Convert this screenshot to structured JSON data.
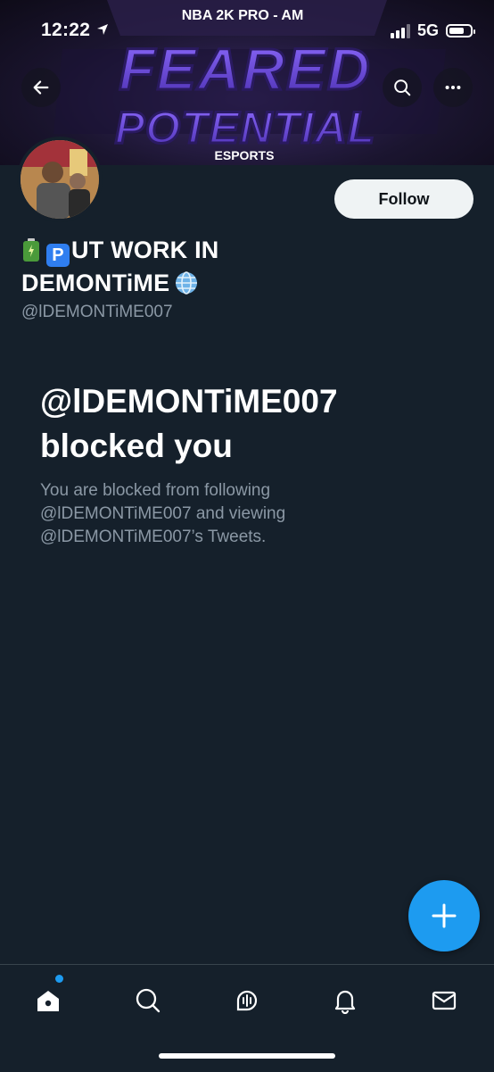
{
  "status_bar": {
    "time": "12:22",
    "network": "5G"
  },
  "banner": {
    "top_text": "NBA 2K PRO - AM",
    "line1": "FEARED",
    "line2": "POTENTIAL",
    "bottom_text": "ESPORTS"
  },
  "profile": {
    "display_name_line1": "UT WORK IN",
    "display_name_line2": "DEMONTiME",
    "handle": "@lDEMONTiME007",
    "follow_label": "Follow"
  },
  "blocked": {
    "title_line1": "@lDEMONTiME007",
    "title_line2": "blocked you",
    "description": "You are blocked from following @lDEMONTiME007 and viewing @lDEMONTiME007’s Tweets."
  },
  "colors": {
    "background": "#15202b",
    "accent": "#1d9bf0",
    "muted_text": "#8b98a5",
    "follow_button_bg": "#eff3f4"
  },
  "icons": {
    "back": "arrow-left-icon",
    "search": "search-icon",
    "more": "more-horizontal-icon",
    "fab": "plus-icon",
    "tabs": [
      "home-icon",
      "search-icon",
      "spaces-icon",
      "bell-icon",
      "mail-icon"
    ]
  }
}
